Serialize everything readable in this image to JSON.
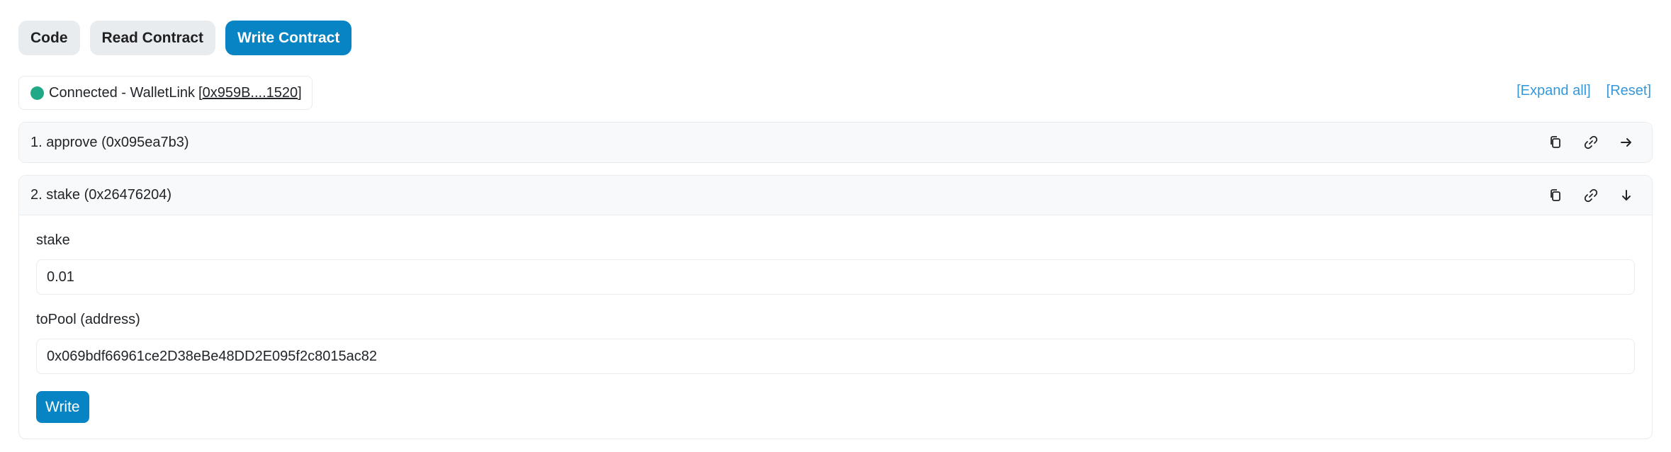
{
  "tabs": [
    {
      "label": "Code"
    },
    {
      "label": "Read Contract"
    },
    {
      "label": "Write Contract",
      "active": true
    }
  ],
  "connection": {
    "status_text": "Connected - WalletLink ",
    "bracket_open": "[",
    "address": "0x959B....1520",
    "bracket_close": "]",
    "status_color": "#1fa987"
  },
  "links": {
    "expand_all": "[Expand all]",
    "reset": "[Reset]"
  },
  "methods": [
    {
      "title": "1. approve (0x095ea7b3)",
      "expanded": false,
      "toggle_icon": "arrow-right-icon"
    },
    {
      "title": "2. stake (0x26476204)",
      "expanded": true,
      "toggle_icon": "arrow-down-icon",
      "fields": [
        {
          "label": "stake",
          "value": "0.01"
        },
        {
          "label": "toPool (address)",
          "value": "0x069bdf66961ce2D38eBe48DD2E095f2c8015ac82"
        }
      ],
      "write_label": "Write"
    }
  ],
  "colors": {
    "accent": "#0784c3",
    "link": "#3498db",
    "connected": "#1fa987"
  }
}
